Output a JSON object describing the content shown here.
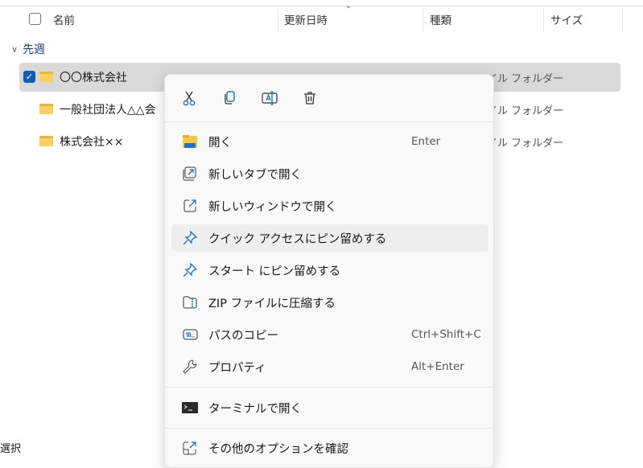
{
  "header": {
    "columns": [
      "名前",
      "更新日時",
      "種類",
      "サイズ"
    ]
  },
  "group": {
    "label": "先週"
  },
  "rows": [
    {
      "name": "〇〇株式会社",
      "type": "ファイル フォルダー",
      "selected": true
    },
    {
      "name": "一般社団法人△△会",
      "type": "ファイル フォルダー",
      "selected": false
    },
    {
      "name": "株式会社××",
      "type": "ファイル フォルダー",
      "selected": false
    }
  ],
  "menu": {
    "toolbar": [
      "cut-icon",
      "copy-icon",
      "rename-icon",
      "delete-icon"
    ],
    "items": [
      {
        "label": "開く",
        "shortcut": "Enter"
      },
      {
        "label": "新しいタブで開く",
        "shortcut": ""
      },
      {
        "label": "新しいウィンドウで開く",
        "shortcut": ""
      },
      {
        "label": "クイック アクセスにピン留めする",
        "shortcut": ""
      },
      {
        "label": "スタート にピン留めする",
        "shortcut": ""
      },
      {
        "label": "ZIP ファイルに圧縮する",
        "shortcut": ""
      },
      {
        "label": "パスのコピー",
        "shortcut": "Ctrl+Shift+C"
      },
      {
        "label": "プロパティ",
        "shortcut": "Alt+Enter"
      },
      {
        "label": "ターミナルで開く",
        "shortcut": ""
      },
      {
        "label": "その他のオプションを確認",
        "shortcut": ""
      }
    ]
  },
  "status": {
    "text": "選択"
  },
  "colors": {
    "accent": "#0a5fb4",
    "selection": "#d9d9d9",
    "icon_blue": "#1a73c9"
  }
}
